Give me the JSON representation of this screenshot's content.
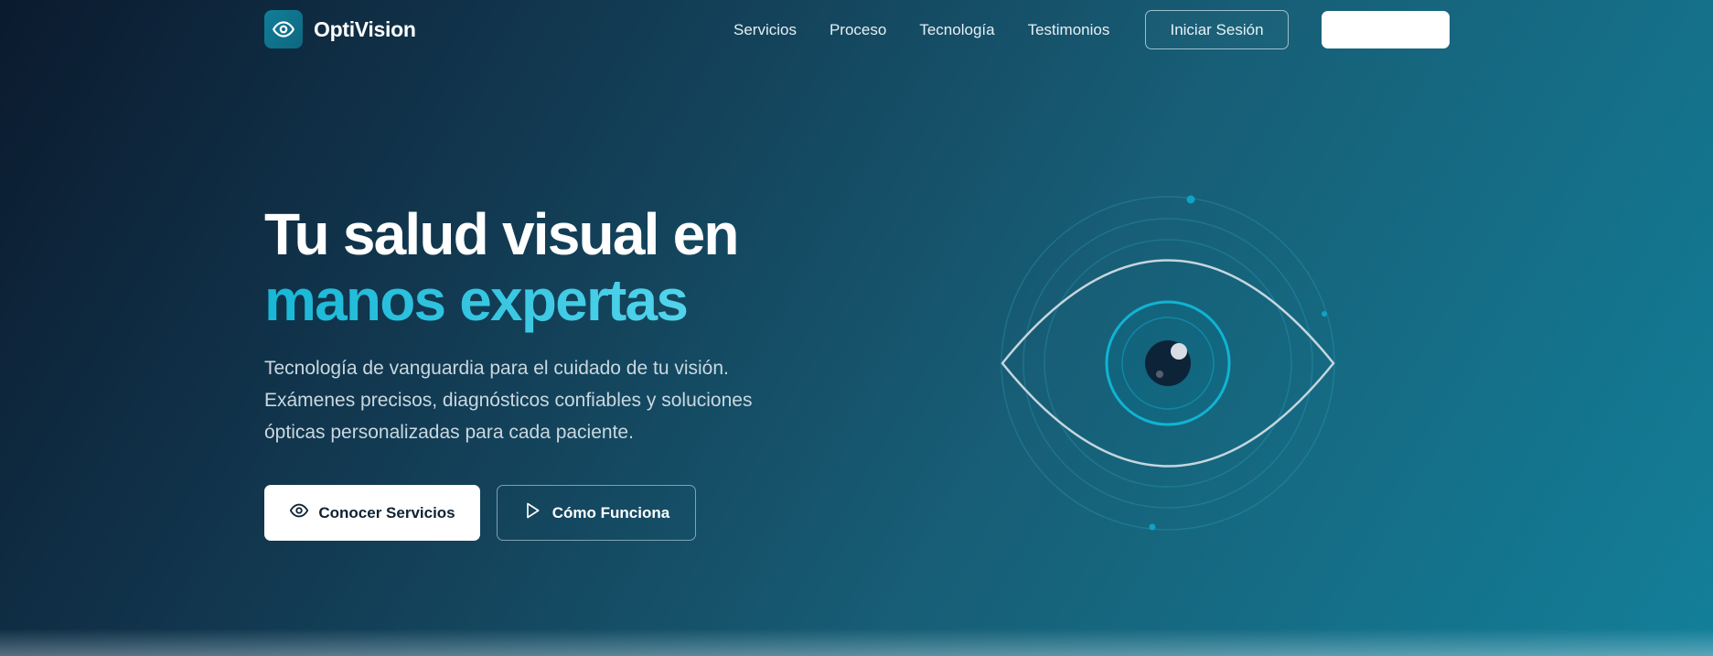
{
  "brand": {
    "name": "OptiVision",
    "icon": "eye-icon"
  },
  "nav": {
    "links": [
      "Servicios",
      "Proceso",
      "Tecnología",
      "Testimonios"
    ],
    "login_label": "Iniciar Sesión",
    "cta_label": ""
  },
  "hero": {
    "title_line1": "Tu salud visual en",
    "title_line2": "manos expertas",
    "description": "Tecnología de vanguardia para el cuidado de tu visión. Exámenes precisos, diagnósticos confiables y soluciones ópticas personalizadas para cada paciente.",
    "primary_button": {
      "label": "Conocer Servicios",
      "icon": "eye-icon"
    },
    "secondary_button": {
      "label": "Cómo Funciona",
      "icon": "play-icon"
    }
  },
  "colors": {
    "accent": "#17b7d6",
    "background_dark": "#0b1a2e",
    "background_light": "#137f99"
  }
}
